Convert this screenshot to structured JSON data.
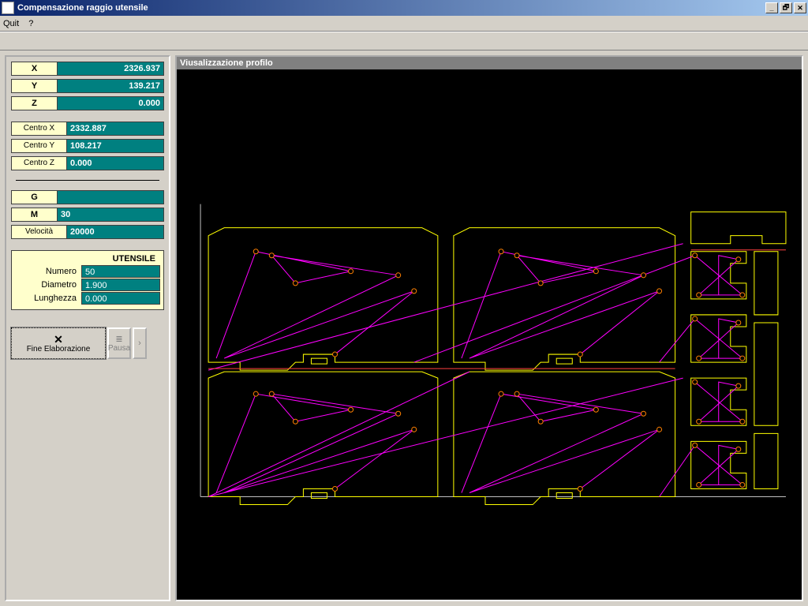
{
  "window": {
    "title": "Compensazione raggio utensile",
    "min": "_",
    "max": "🗗",
    "close": "✕"
  },
  "menu": {
    "quit": "Quit",
    "help": "?"
  },
  "coords": {
    "x_label": "X",
    "x_val": "2326.937",
    "y_label": "Y",
    "y_val": "139.217",
    "z_label": "Z",
    "z_val": "0.000"
  },
  "center": {
    "cx_label": "Centro X",
    "cx_val": "2332.887",
    "cy_label": "Centro Y",
    "cy_val": "108.217",
    "cz_label": "Centro Z",
    "cz_val": "0.000"
  },
  "gm": {
    "g_label": "G",
    "g_val": "",
    "m_label": "M",
    "m_val": "30",
    "v_label": "Velocità",
    "v_val": "20000"
  },
  "tool": {
    "header": "UTENSILE",
    "num_label": "Numero",
    "num_val": "50",
    "dia_label": "Diametro",
    "dia_val": "1.900",
    "len_label": "Lunghezza",
    "len_val": "0.000"
  },
  "buttons": {
    "fine_glyph": "✕",
    "fine_label": "Fine Elaborazione",
    "pause_glyph": "≣",
    "pause_label": "Pausa",
    "next": "›"
  },
  "vis": {
    "header": "Viusalizzazione profilo"
  }
}
